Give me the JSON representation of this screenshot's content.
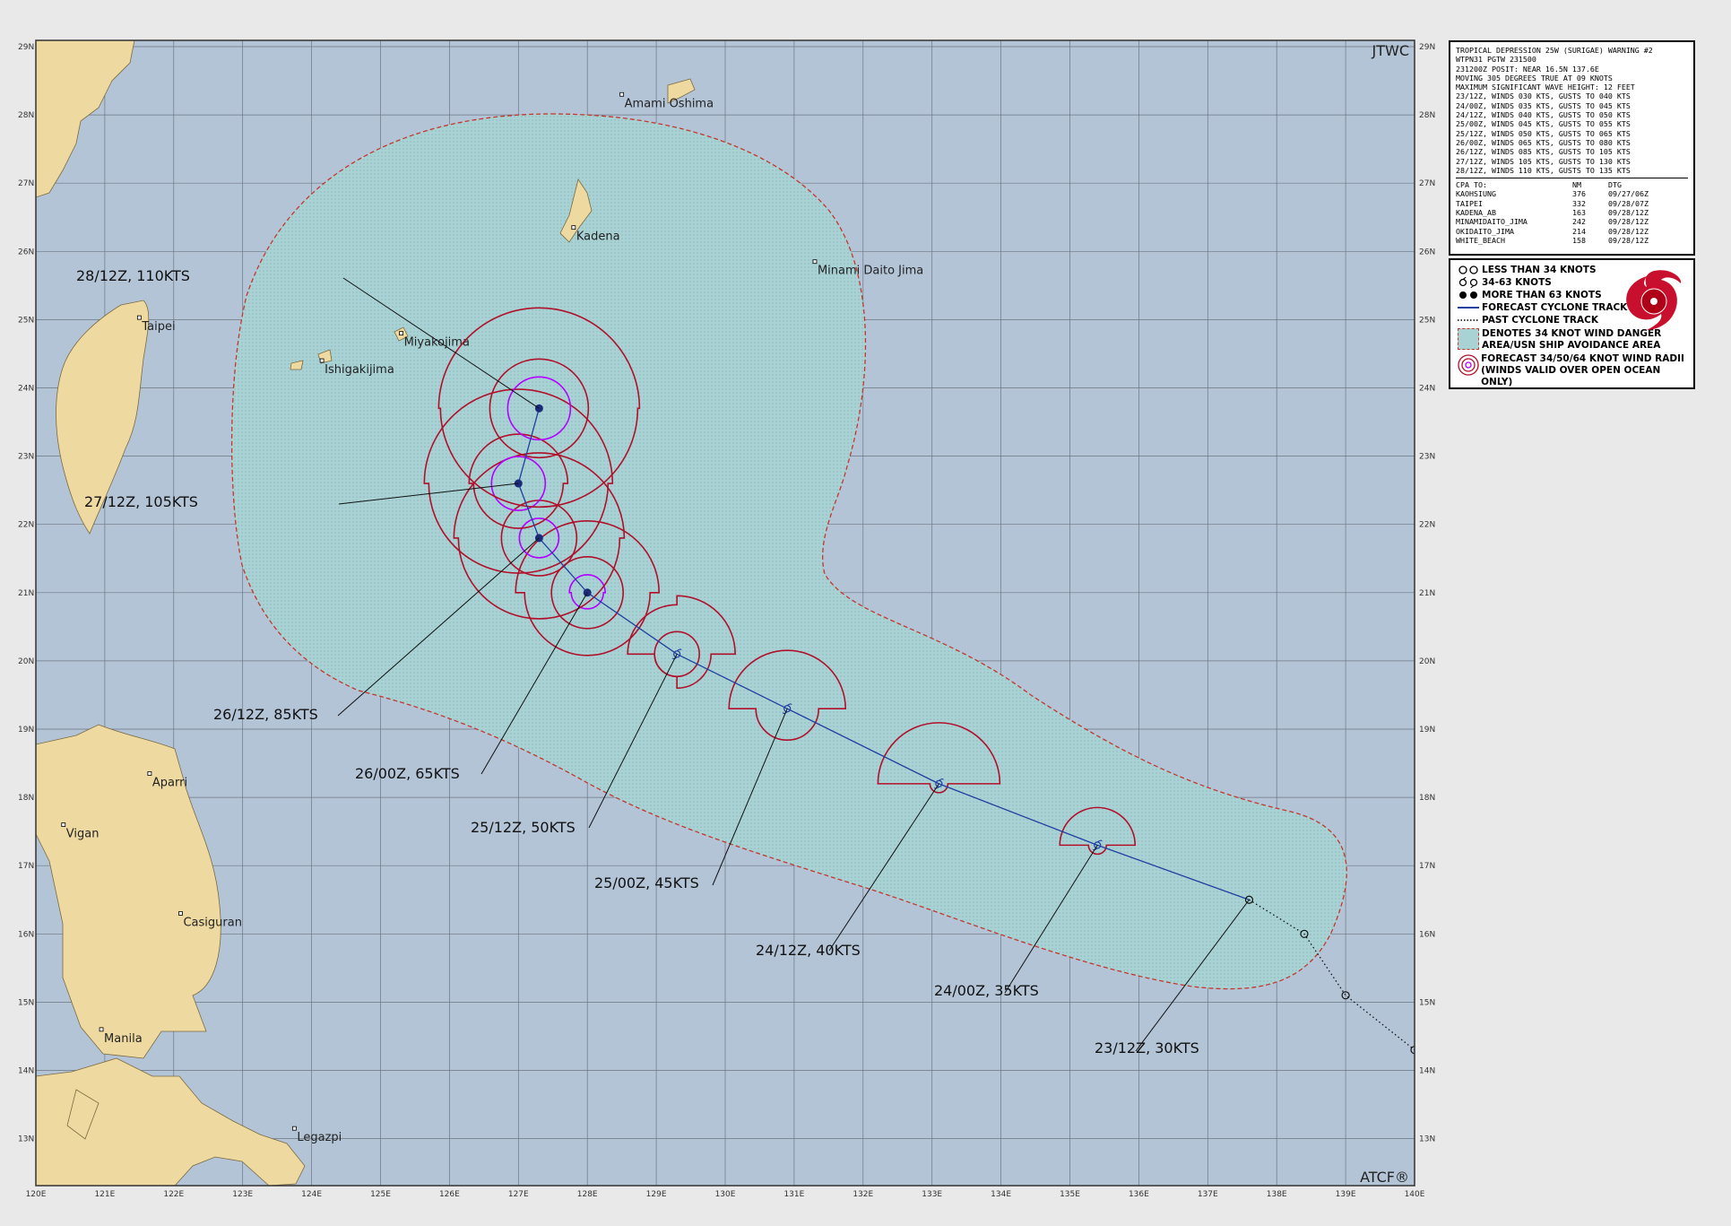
{
  "map": {
    "agency": "JTWC",
    "footer": "ATCF®",
    "lon_labels": [
      "120E",
      "121E",
      "122E",
      "123E",
      "124E",
      "125E",
      "126E",
      "127E",
      "128E",
      "129E",
      "130E",
      "131E",
      "132E",
      "133E",
      "134E",
      "135E",
      "136E",
      "137E",
      "138E",
      "139E",
      "140E"
    ],
    "lat_labels": [
      "29N",
      "28N",
      "27N",
      "26N",
      "25N",
      "24N",
      "23N",
      "22N",
      "21N",
      "20N",
      "19N",
      "18N",
      "17N",
      "16N",
      "15N",
      "14N",
      "13N"
    ],
    "places": [
      {
        "name": "Amami Oshima",
        "lon": 128.5,
        "lat": 28.3
      },
      {
        "name": "Kadena",
        "lon": 127.8,
        "lat": 26.35
      },
      {
        "name": "Minami Daito Jima",
        "lon": 131.3,
        "lat": 25.85
      },
      {
        "name": "Taipei",
        "lon": 121.5,
        "lat": 25.03
      },
      {
        "name": "Miyakojima",
        "lon": 125.3,
        "lat": 24.8
      },
      {
        "name": "Ishigakijima",
        "lon": 124.15,
        "lat": 24.4
      },
      {
        "name": "Aparri",
        "lon": 121.65,
        "lat": 18.35
      },
      {
        "name": "Vigan",
        "lon": 120.4,
        "lat": 17.6
      },
      {
        "name": "Casiguran",
        "lon": 122.1,
        "lat": 16.3
      },
      {
        "name": "Manila",
        "lon": 120.95,
        "lat": 14.6
      },
      {
        "name": "Legazpi",
        "lon": 123.75,
        "lat": 13.15
      }
    ],
    "forecast_track": [
      {
        "label": "23/12Z,  30KTS",
        "lon": 137.6,
        "lat": 16.5,
        "intensity": "lt34"
      },
      {
        "label": "24/00Z,  35KTS",
        "lon": 135.4,
        "lat": 17.3,
        "intensity": "34to63"
      },
      {
        "label": "24/12Z,  40KTS",
        "lon": 133.1,
        "lat": 18.2,
        "intensity": "34to63"
      },
      {
        "label": "25/00Z,  45KTS",
        "lon": 130.9,
        "lat": 19.3,
        "intensity": "34to63"
      },
      {
        "label": "25/12Z,  50KTS",
        "lon": 129.3,
        "lat": 20.1,
        "intensity": "34to63"
      },
      {
        "label": "26/00Z,  65KTS",
        "lon": 128.0,
        "lat": 21.0,
        "intensity": "gt63"
      },
      {
        "label": "26/12Z,  85KTS",
        "lon": 127.3,
        "lat": 21.8,
        "intensity": "gt63"
      },
      {
        "label": "27/12Z, 105KTS",
        "lon": 127.0,
        "lat": 22.6,
        "intensity": "gt63"
      },
      {
        "label": "28/12Z, 110KTS",
        "lon": 127.3,
        "lat": 23.7,
        "intensity": "gt63"
      }
    ],
    "past_track": [
      {
        "lon": 137.6,
        "lat": 16.5
      },
      {
        "lon": 138.4,
        "lat": 16.0
      },
      {
        "lon": 139.0,
        "lat": 15.1
      },
      {
        "lon": 140.0,
        "lat": 14.3
      }
    ]
  },
  "info": {
    "lines": [
      "TROPICAL DEPRESSION 25W (SURIGAE) WARNING #2",
      "WTPN31 PGTW 231500",
      "231200Z POSIT: NEAR 16.5N 137.6E",
      "MOVING 305 DEGREES TRUE AT 09 KNOTS",
      "MAXIMUM SIGNIFICANT WAVE HEIGHT: 12 FEET",
      "23/12Z, WINDS 030 KTS, GUSTS TO 040 KTS",
      "24/00Z, WINDS 035 KTS, GUSTS TO 045 KTS",
      "24/12Z, WINDS 040 KTS, GUSTS TO 050 KTS",
      "25/00Z, WINDS 045 KTS, GUSTS TO 055 KTS",
      "25/12Z, WINDS 050 KTS, GUSTS TO 065 KTS",
      "26/00Z, WINDS 065 KTS, GUSTS TO 080 KTS",
      "26/12Z, WINDS 085 KTS, GUSTS TO 105 KTS",
      "27/12Z, WINDS 105 KTS, GUSTS TO 130 KTS",
      "28/12Z, WINDS 110 KTS, GUSTS TO 135 KTS"
    ],
    "cpa_header": [
      "CPA TO:",
      "NM",
      "DTG"
    ],
    "cpa": [
      [
        "KAOHSIUNG",
        "376",
        "09/27/06Z"
      ],
      [
        "TAIPEI",
        "332",
        "09/28/07Z"
      ],
      [
        "KADENA_AB",
        "163",
        "09/28/12Z"
      ],
      [
        "MINAMIDAITO_JIMA",
        "242",
        "09/28/12Z"
      ],
      [
        "OKIDAITO_JIMA",
        "214",
        "09/28/12Z"
      ],
      [
        "WHITE_BEACH",
        "158",
        "09/28/12Z"
      ]
    ]
  },
  "legend": {
    "items": [
      "LESS THAN 34 KNOTS",
      "34-63 KNOTS",
      "MORE THAN 63 KNOTS",
      "FORECAST CYCLONE TRACK",
      "PAST CYCLONE TRACK"
    ],
    "danger_area": [
      "DENOTES 34 KNOT WIND DANGER",
      "AREA/USN SHIP AVOIDANCE AREA"
    ],
    "wind_radii": [
      "FORECAST 34/50/64 KNOT WIND RADII",
      "(WINDS VALID OVER OPEN OCEAN ONLY)"
    ]
  },
  "colors": {
    "ocean": "#b4c4d7",
    "land": "#eed9a0",
    "danger": "#a9d2d5",
    "track": "#1f3fa0",
    "r34": "#b0102a",
    "r64": "#b300ff",
    "grid": "#6c7680"
  }
}
